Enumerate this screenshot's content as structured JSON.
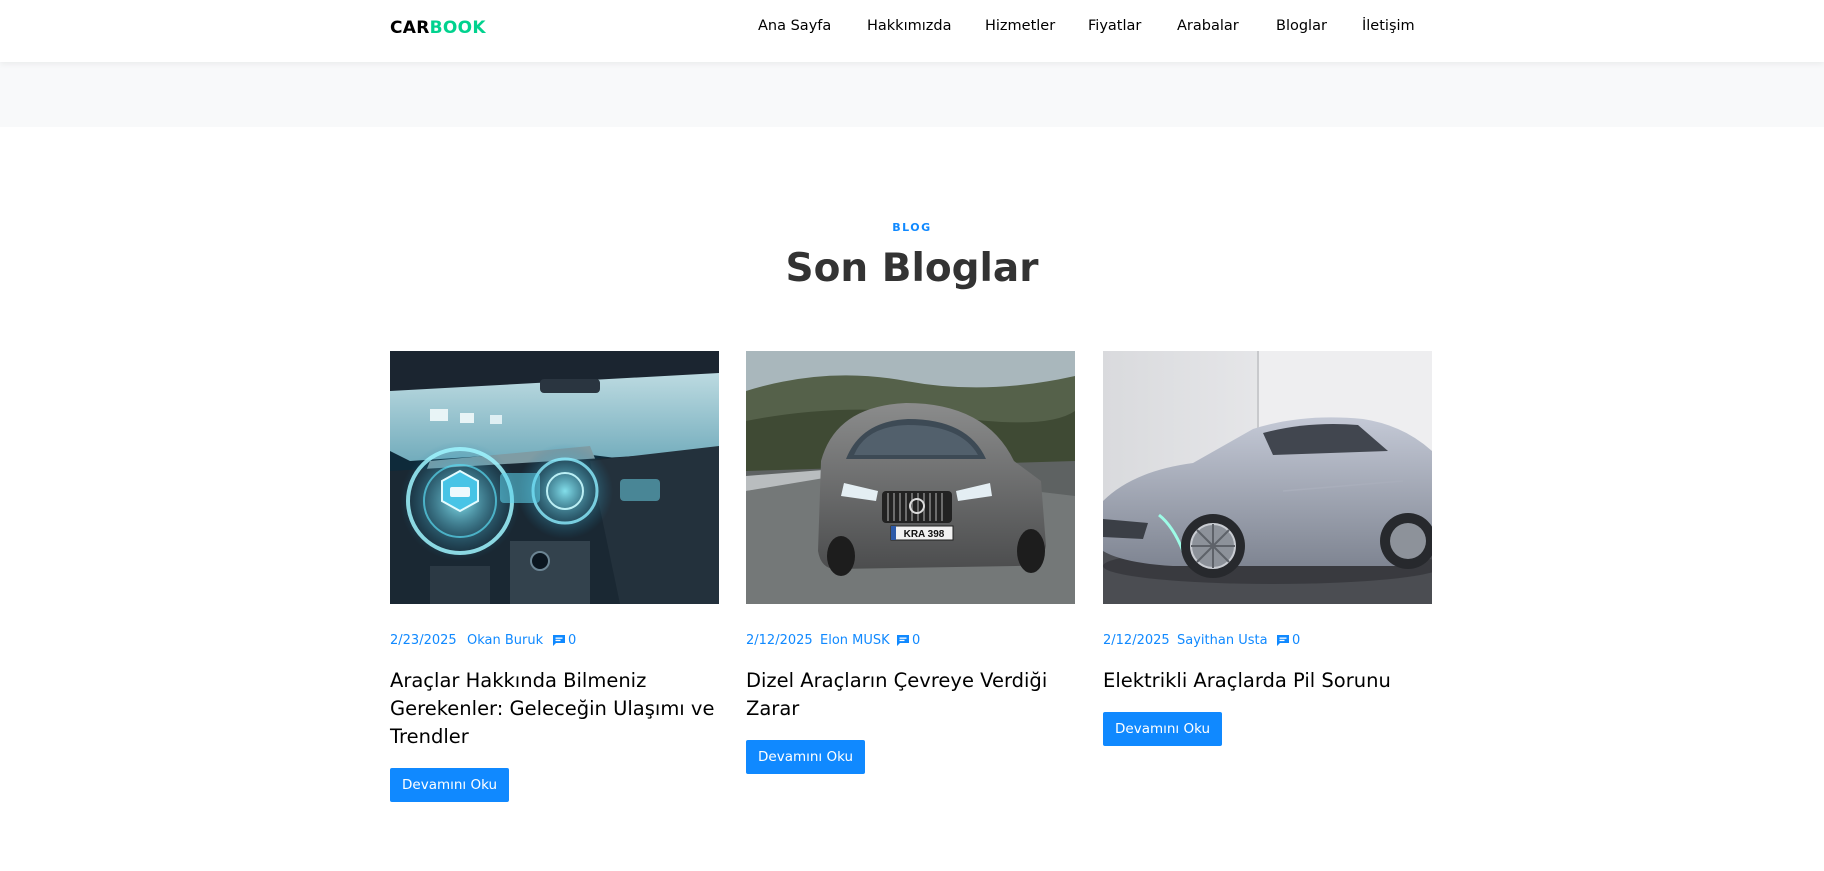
{
  "brand": {
    "part1": "CAR",
    "part2": "BOOK"
  },
  "nav": {
    "items": [
      {
        "label": "Ana Sayfa"
      },
      {
        "label": "Hakkımızda"
      },
      {
        "label": "Hizmetler"
      },
      {
        "label": "Fiyatlar"
      },
      {
        "label": "Arabalar"
      },
      {
        "label": "Bloglar"
      },
      {
        "label": "İletişim"
      }
    ]
  },
  "section": {
    "subheading": "BLOG",
    "title": "Son Bloglar"
  },
  "posts": [
    {
      "date": "2/23/2025",
      "author": "Okan Buruk",
      "comments": "0",
      "title": "Araçlar Hakkında Bilmeniz Gerekenler: Geleceğin Ulaşımı ve Trendler",
      "button": "Devamını Oku"
    },
    {
      "date": "2/12/2025",
      "author": "Elon MUSK",
      "comments": "0",
      "title": "Dizel Araçların Çevreye Verdiği Zarar",
      "button": "Devamını Oku",
      "plate": "KRA 398"
    },
    {
      "date": "2/12/2025",
      "author": "Sayithan Usta",
      "comments": "0",
      "title": "Elektrikli Araçlarda Pil Sorunu",
      "button": "Devamını Oku"
    }
  ],
  "colors": {
    "accent": "#1089ff",
    "brand_green": "#01d28e",
    "band": "#f8f9fa"
  },
  "icons": {
    "comment": "chat-bubble-icon"
  }
}
